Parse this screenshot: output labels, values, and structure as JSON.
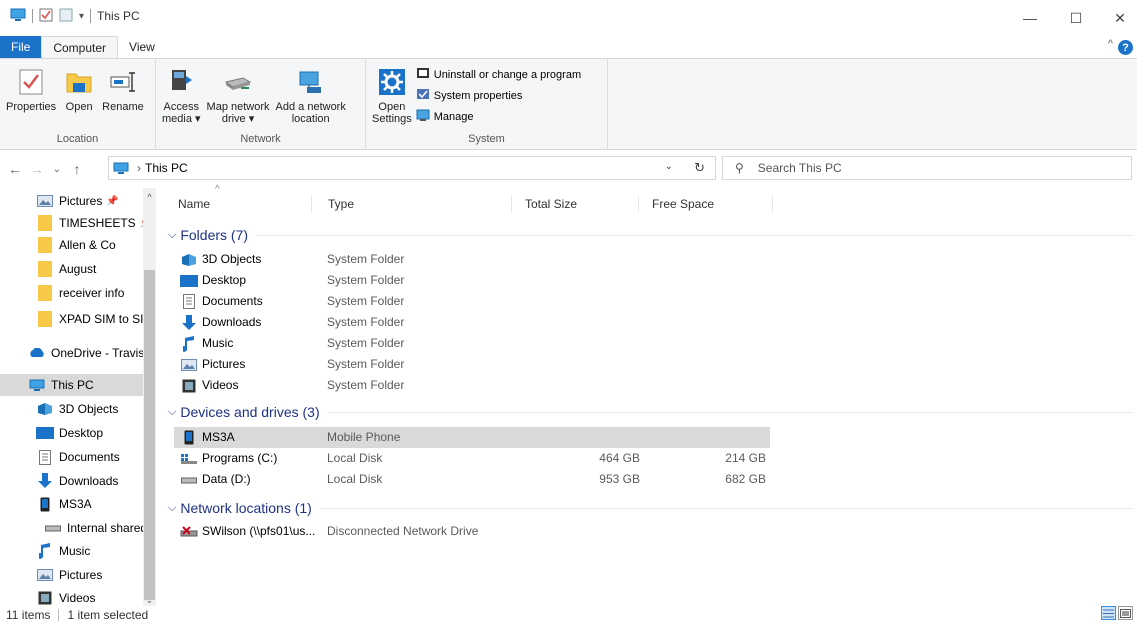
{
  "window": {
    "title": "This PC",
    "minimize": "—",
    "maximize": "☐",
    "close": "✕"
  },
  "ribbon_tabs": [
    "File",
    "Computer",
    "View"
  ],
  "ribbon": {
    "location": {
      "label": "Location",
      "buttons": [
        "Properties",
        "Open",
        "Rename"
      ]
    },
    "network": {
      "label": "Network",
      "access_media": [
        "Access",
        "media ▾"
      ],
      "map_drive": [
        "Map network",
        "drive ▾"
      ],
      "add_location": [
        "Add a network",
        "location"
      ]
    },
    "system": {
      "label": "System",
      "open_settings": [
        "Open",
        "Settings"
      ],
      "uninstall": "Uninstall or change a program",
      "sys_props": "System properties",
      "manage": "Manage"
    }
  },
  "address": {
    "path": "This PC",
    "search_placeholder": "Search This PC"
  },
  "nav": {
    "items": [
      {
        "label": "Pictures",
        "pinned": true
      },
      {
        "label": "TIMESHEETS",
        "pinned": true
      },
      {
        "label": "Allen & Co"
      },
      {
        "label": "August"
      },
      {
        "label": "receiver info"
      },
      {
        "label": "XPAD SIM to SIM"
      },
      {
        "label": "OneDrive - Travis"
      },
      {
        "label": "This PC"
      },
      {
        "label": "3D Objects"
      },
      {
        "label": "Desktop"
      },
      {
        "label": "Documents"
      },
      {
        "label": "Downloads"
      },
      {
        "label": "MS3A"
      },
      {
        "label": "Internal shared"
      },
      {
        "label": "Music"
      },
      {
        "label": "Pictures"
      },
      {
        "label": "Videos"
      }
    ]
  },
  "columns": [
    "Name",
    "Type",
    "Total Size",
    "Free Space"
  ],
  "groups": {
    "folders": {
      "header": "Folders (7)",
      "rows": [
        {
          "name": "3D Objects",
          "type": "System Folder"
        },
        {
          "name": "Desktop",
          "type": "System Folder"
        },
        {
          "name": "Documents",
          "type": "System Folder"
        },
        {
          "name": "Downloads",
          "type": "System Folder"
        },
        {
          "name": "Music",
          "type": "System Folder"
        },
        {
          "name": "Pictures",
          "type": "System Folder"
        },
        {
          "name": "Videos",
          "type": "System Folder"
        }
      ]
    },
    "devices": {
      "header": "Devices and drives (3)",
      "rows": [
        {
          "name": "MS3A",
          "type": "Mobile Phone",
          "total": "",
          "free": ""
        },
        {
          "name": "Programs (C:)",
          "type": "Local Disk",
          "total": "464 GB",
          "free": "214 GB"
        },
        {
          "name": "Data (D:)",
          "type": "Local Disk",
          "total": "953 GB",
          "free": "682 GB"
        }
      ]
    },
    "network": {
      "header": "Network locations (1)",
      "rows": [
        {
          "name": "SWilson (\\\\pfs01\\us...",
          "type": "Disconnected Network Drive"
        }
      ]
    }
  },
  "status": {
    "items": "11 items",
    "selected": "1 item selected"
  },
  "colors": {
    "accent": "#1a73c8",
    "group_header": "#1e3287",
    "selection": "#d9d9d9"
  }
}
